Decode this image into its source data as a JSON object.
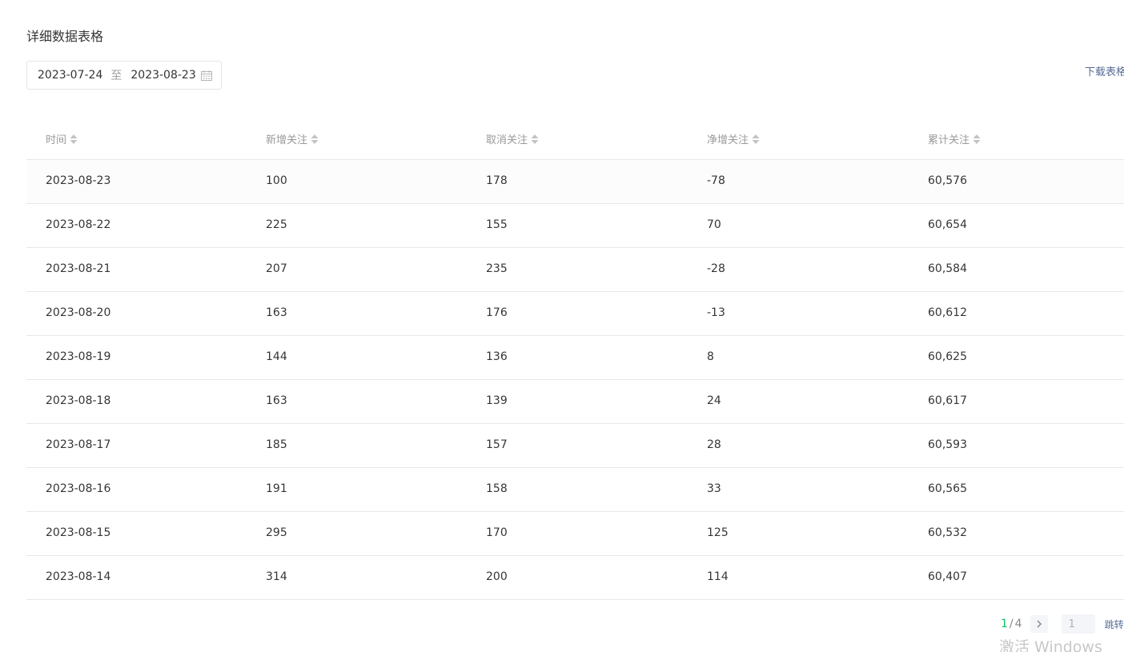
{
  "section": {
    "title": "详细数据表格"
  },
  "date_range": {
    "start": "2023-07-24",
    "separator": "至",
    "end": "2023-08-23",
    "icon": "calendar-icon"
  },
  "actions": {
    "download_label": "下载表格"
  },
  "table": {
    "columns": [
      "时间",
      "新增关注",
      "取消关注",
      "净增关注",
      "累计关注"
    ],
    "rows": [
      [
        "2023-08-23",
        "100",
        "178",
        "-78",
        "60,576"
      ],
      [
        "2023-08-22",
        "225",
        "155",
        "70",
        "60,654"
      ],
      [
        "2023-08-21",
        "207",
        "235",
        "-28",
        "60,584"
      ],
      [
        "2023-08-20",
        "163",
        "176",
        "-13",
        "60,612"
      ],
      [
        "2023-08-19",
        "144",
        "136",
        "8",
        "60,625"
      ],
      [
        "2023-08-18",
        "163",
        "139",
        "24",
        "60,617"
      ],
      [
        "2023-08-17",
        "185",
        "157",
        "28",
        "60,593"
      ],
      [
        "2023-08-16",
        "191",
        "158",
        "33",
        "60,565"
      ],
      [
        "2023-08-15",
        "295",
        "170",
        "125",
        "60,532"
      ],
      [
        "2023-08-14",
        "314",
        "200",
        "114",
        "60,407"
      ]
    ]
  },
  "pagination": {
    "current": "1",
    "separator": "/",
    "total": "4",
    "next_icon": "chevron-right-icon",
    "input_value": "1",
    "jump_label": "跳转"
  },
  "watermark": {
    "text": "激活 Windows"
  },
  "colors": {
    "accent_green": "#07c160",
    "link_blue": "#576b95",
    "border": "#e7e7eb",
    "muted_text": "#9a9a9a"
  }
}
